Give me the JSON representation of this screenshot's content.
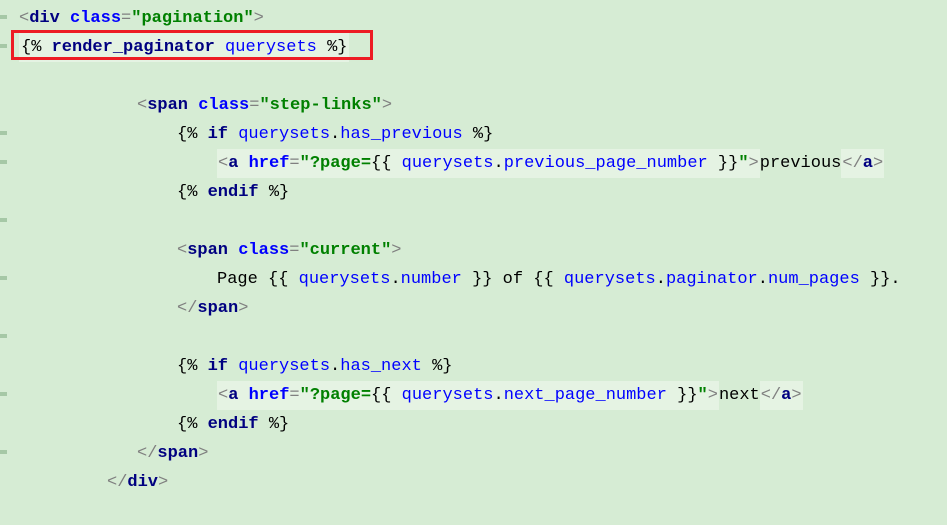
{
  "lines": {
    "l1": {
      "open_angle": "<",
      "tag": "div",
      "space": " ",
      "attr": "class",
      "eq": "=",
      "q1": "\"",
      "val": "pagination",
      "q2": "\"",
      "close_angle": ">"
    },
    "l2": {
      "open": "{% ",
      "kw": "render_paginator",
      "space": " ",
      "var": "querysets",
      "close": " %}"
    },
    "l4": {
      "open_angle": "<",
      "tag": "span",
      "space": " ",
      "attr": "class",
      "eq": "=",
      "q1": "\"",
      "val": "step-links",
      "q2": "\"",
      "close_angle": ">"
    },
    "l5": {
      "open": "{% ",
      "kw": "if",
      "sp1": " ",
      "var1": "querysets",
      "dot": ".",
      "var2": "has_previous",
      "close": " %}"
    },
    "l6": {
      "open_angle": "<",
      "tag": "a",
      "sp1": " ",
      "attr": "href",
      "eq": "=",
      "q1": "\"",
      "href_prefix": "?page=",
      "dl_open": "{{ ",
      "var1": "querysets",
      "dot": ".",
      "var2": "previous_page_number",
      "dl_close": " }}",
      "q2": "\"",
      "close1": ">",
      "text": "previous",
      "open2": "</",
      "tag2": "a",
      "close2": ">"
    },
    "l7": {
      "open": "{% ",
      "kw": "endif",
      "close": " %}"
    },
    "l9": {
      "open_angle": "<",
      "tag": "span",
      "space": " ",
      "attr": "class",
      "eq": "=",
      "q1": "\"",
      "val": "current",
      "q2": "\"",
      "close_angle": ">"
    },
    "l10": {
      "t1": "Page ",
      "o1": "{{ ",
      "v1a": "querysets",
      "d1": ".",
      "v1b": "number",
      "c1": " }}",
      "t2": " of ",
      "o2": "{{ ",
      "v2a": "querysets",
      "d2": ".",
      "v2b": "paginator",
      "d3": ".",
      "v2c": "num_pages",
      "c2": " }}",
      "t3": "."
    },
    "l11": {
      "open": "</",
      "tag": "span",
      "close": ">"
    },
    "l13": {
      "open": "{% ",
      "kw": "if",
      "sp1": " ",
      "var1": "querysets",
      "dot": ".",
      "var2": "has_next",
      "close": " %}"
    },
    "l14": {
      "open_angle": "<",
      "tag": "a",
      "sp1": " ",
      "attr": "href",
      "eq": "=",
      "q1": "\"",
      "href_prefix": "?page=",
      "dl_open": "{{ ",
      "var1": "querysets",
      "dot": ".",
      "var2": "next_page_number",
      "dl_close": " }}",
      "q2": "\"",
      "close1": ">",
      "text": "next",
      "open2": "</",
      "tag2": "a",
      "close2": ">"
    },
    "l15": {
      "open": "{% ",
      "kw": "endif",
      "close": " %}"
    },
    "l16": {
      "open": "</",
      "tag": "span",
      "close": ">"
    },
    "l17": {
      "open": "</",
      "tag": "div",
      "close": ">"
    }
  }
}
